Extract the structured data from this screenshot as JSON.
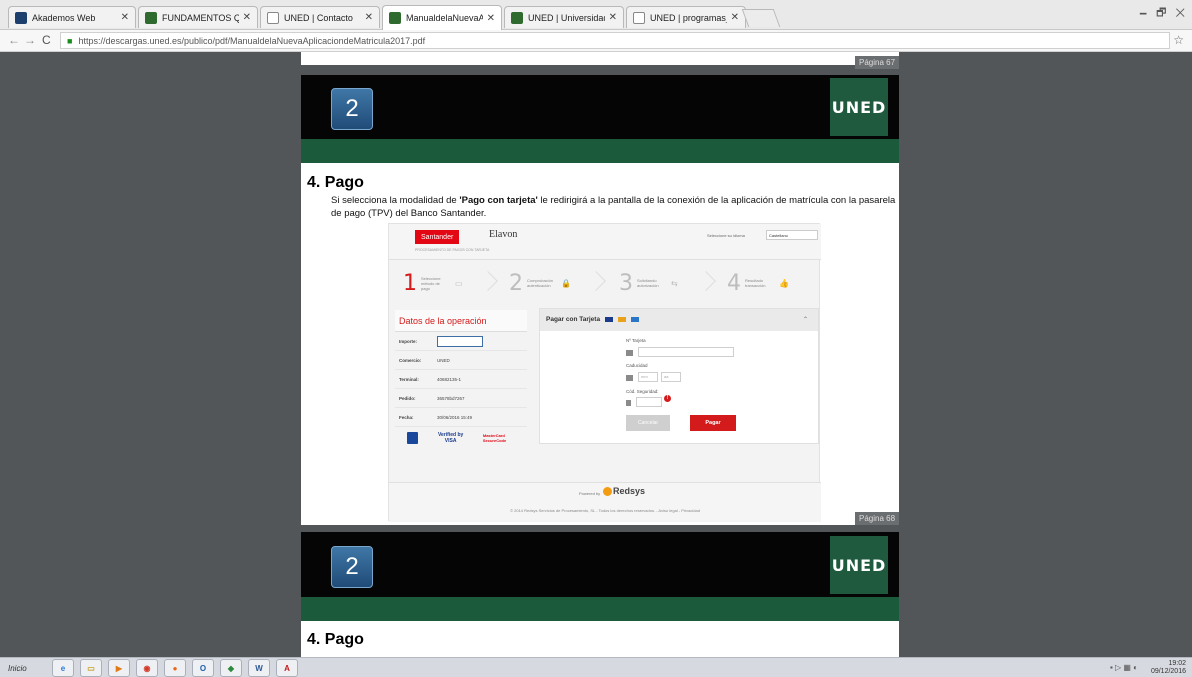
{
  "tabs": [
    {
      "title": "Akademos Web",
      "fav": "dark",
      "active": false
    },
    {
      "title": "FUNDAMENTOS QUÍMICOS",
      "fav": "dark",
      "active": false
    },
    {
      "title": "UNED | Contacto",
      "fav": "doc",
      "active": false
    },
    {
      "title": "ManualdelaNuevaAplicacion",
      "fav": "dark",
      "active": true
    },
    {
      "title": "UNED | Universidad Nacion",
      "fav": "dark",
      "active": false
    },
    {
      "title": "UNED | programas_doctora",
      "fav": "doc",
      "active": false
    }
  ],
  "window_controls": "🗕 🗗 ✕",
  "address": {
    "url": "https://descargas.uned.es/publico/pdf/ManualdelaNuevaAplicaciondeMatricula2017.pdf"
  },
  "pdf": {
    "page_top_label": "Página 67",
    "page_mid_label": "Página 68",
    "chapter_number": "2",
    "logo_text": "UNED",
    "section_title": "4. Pago",
    "para_part1": "Si selecciona la modalidad de ",
    "para_bold": "'Pago con tarjeta'",
    "para_part2": " le redirigirá a la pantalla de la conexión de la aplicación de matrícula con la pasarela de pago (TPV) del Banco Santander.",
    "second_chapter_number": "2",
    "second_logo_text": "UNED",
    "second_section_title": "4. Pago"
  },
  "tpv": {
    "bank": "Santander",
    "partner": "Elavon",
    "tagline": "PROCESAMIENTO DE PAGOS CON TARJETA",
    "language_label": "Seleccione su idioma",
    "language_value": "Castellano",
    "steps": [
      {
        "n": "1",
        "t": "Seleccione método de pago",
        "icon": "▭"
      },
      {
        "n": "2",
        "t": "Comprobación autenticación",
        "icon": "🔒"
      },
      {
        "n": "3",
        "t": "Solicitando autorización",
        "icon": "⇆"
      },
      {
        "n": "4",
        "t": "Resultado transacción",
        "icon": "👍"
      }
    ],
    "datos_title": "Datos de la operación",
    "datos": [
      {
        "k": "Importe:",
        "v": ""
      },
      {
        "k": "Comercio:",
        "v": "UNED"
      },
      {
        "k": "Terminal:",
        "v": "40682135-1"
      },
      {
        "k": "Pedido:",
        "v": "36578bd7267"
      },
      {
        "k": "Fecha:",
        "v": "30/06/2016  15:49"
      }
    ],
    "verified_visa": "Verified by VISA",
    "mastercard": "MasterCard SecureCode",
    "pagar_title": "Pagar con Tarjeta",
    "card_label": "Nº Tarjeta",
    "expiry_label": "Caducidad",
    "mm_placeholder": "mm",
    "aa_placeholder": "aa",
    "cvv_label": "Cód. Seguridad:",
    "cancel_button": "Cancelar",
    "pay_button": "Pagar",
    "powered_by": "Powered by",
    "redsys": "Redsys",
    "copyright": "© 2014 Redsys Servicios de Procesamiento, SL - Todos los derechos reservados. - Aviso legal - Privacidad"
  },
  "taskbar": {
    "start": "Inicio",
    "time": "19:02",
    "date": "09/12/2016"
  }
}
